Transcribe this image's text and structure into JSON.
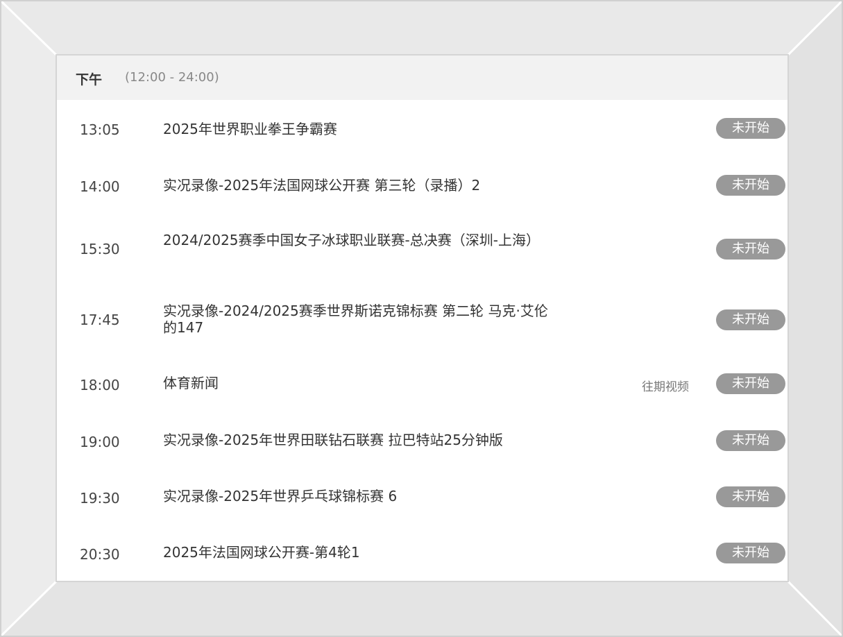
{
  "schedule": {
    "period": "下午",
    "period_range": "(12:00 - 24:00)",
    "items": [
      {
        "time": "13:05",
        "title": "2025年世界职业拳王争霸赛",
        "status": "未开始"
      },
      {
        "time": "14:00",
        "title": "实况录像-2025年法国网球公开赛 第三轮（录播）2",
        "status": "未开始"
      },
      {
        "time": "15:30",
        "title": "2024/2025赛季中国女子冰球职业联赛-总决赛（深圳-上海）",
        "status": "未开始"
      },
      {
        "time": "17:45",
        "title": "实况录像-2024/2025赛季世界斯诺克锦标赛 第二轮 马克·艾伦的147",
        "status": "未开始"
      },
      {
        "time": "18:00",
        "title": "体育新闻",
        "replay": "往期视频",
        "status": "未开始"
      },
      {
        "time": "19:00",
        "title": "实况录像-2025年世界田联钻石联赛 拉巴特站25分钟版",
        "status": "未开始"
      },
      {
        "time": "19:30",
        "title": "实况录像-2025年世界乒乓球锦标赛 6",
        "status": "未开始"
      },
      {
        "time": "20:30",
        "title": "2025年法国网球公开赛-第4轮1",
        "status": "未开始"
      }
    ]
  },
  "colors": {
    "status_badge": "#999999",
    "header_bg": "#f2f2f2",
    "frame": "#e6e6e6"
  }
}
